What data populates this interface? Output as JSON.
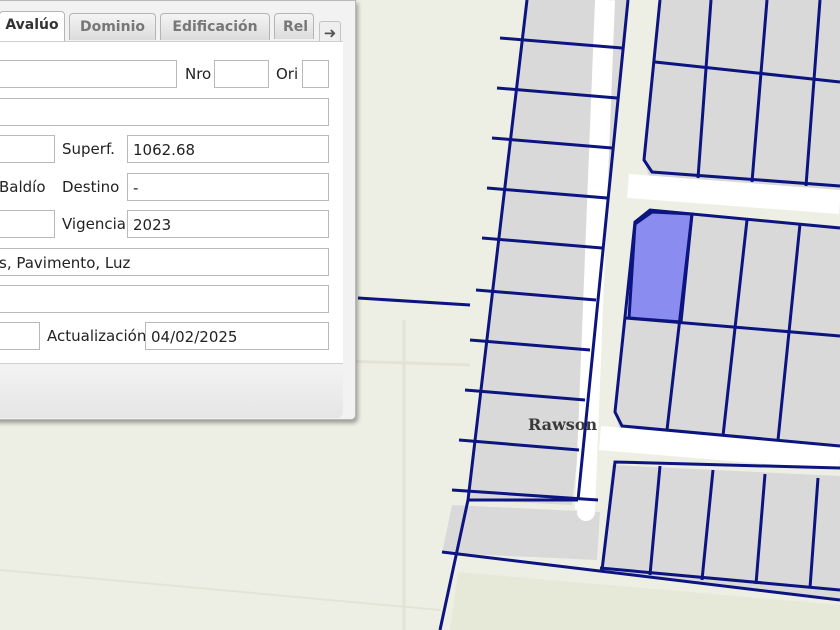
{
  "tabs": [
    {
      "label": "Avalúo",
      "active": true
    },
    {
      "label": "Dominio",
      "active": false
    },
    {
      "label": "Edificación",
      "active": false
    },
    {
      "label": "Rel",
      "active": false
    }
  ],
  "tab_scroll_icon": "arrow-right-icon",
  "form": {
    "calle": "",
    "nro_label": "Nro",
    "nro": "",
    "ori_label": "Ori",
    "ori": "",
    "row2": "",
    "row3_left": "",
    "superf_label": "Superf.",
    "superf": "1062.68",
    "row4_left": "Baldío",
    "destino_label": "Destino",
    "destino": "-",
    "row5_left": "",
    "vigencia_label": "Vigencia",
    "vigencia": "2023",
    "servicios": "s, Pavimento, Luz",
    "row7": "",
    "row8_left": "",
    "actualizacion_label": "Actualización",
    "actualizacion": "04/02/2025"
  },
  "map": {
    "town_label": "Rawson",
    "colors": {
      "background": "#eeefe4",
      "block": "#d9d9d9",
      "street": "#ffffff",
      "parcel_line": "#0c1480",
      "selected_parcel": "#8a8cf0"
    }
  }
}
